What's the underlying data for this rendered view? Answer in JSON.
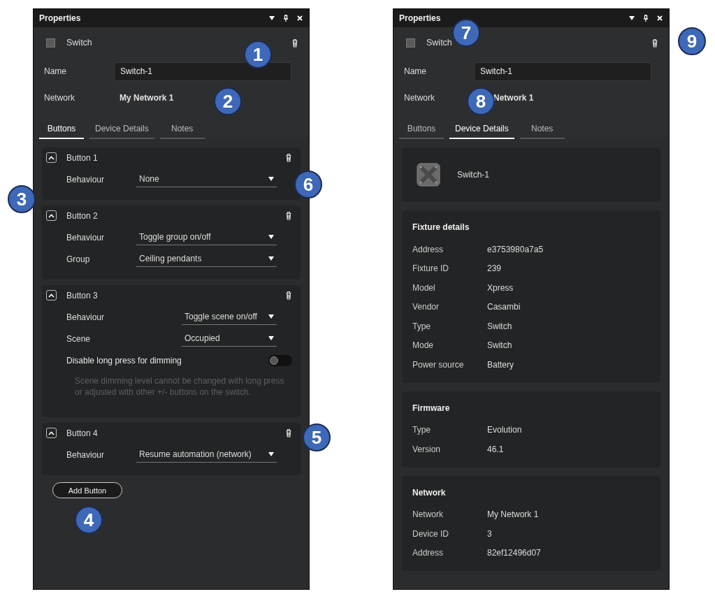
{
  "panels": [
    {
      "title": "Properties",
      "header": {
        "label": "Switch"
      },
      "name_field": {
        "label": "Name",
        "value": "Switch-1"
      },
      "network": {
        "label": "Network",
        "value": "My Network 1"
      },
      "tabs": [
        {
          "label": "Buttons",
          "selected": true
        },
        {
          "label": "Device Details",
          "selected": false
        },
        {
          "label": "Notes",
          "selected": false
        }
      ],
      "content": {
        "kind": "buttons",
        "buttons": [
          {
            "title": "Button 1",
            "expanded": true,
            "rows": [
              {
                "kind": "select",
                "label": "Behaviour",
                "value": "None"
              }
            ]
          },
          {
            "title": "Button 2",
            "expanded": true,
            "rows": [
              {
                "kind": "select",
                "label": "Behaviour",
                "value": "Toggle group on/off"
              },
              {
                "kind": "select",
                "label": "Group",
                "value": "Ceiling pendants"
              }
            ]
          },
          {
            "title": "Button 3",
            "expanded": true,
            "rows": [
              {
                "kind": "select",
                "label": "Behaviour",
                "value": "Toggle scene on/off"
              },
              {
                "kind": "select",
                "label": "Scene",
                "value": "Occupied"
              },
              {
                "kind": "toggle",
                "label": "Disable long press for dimming",
                "on": false
              },
              {
                "kind": "note",
                "text": "Scene dimming level cannot be changed with long press or adjusted with other +/- buttons on the switch."
              }
            ]
          },
          {
            "title": "Button 4",
            "expanded": true,
            "rows": [
              {
                "kind": "select",
                "label": "Behaviour",
                "value": "Resume automation (network)"
              }
            ]
          }
        ],
        "add_button": "Add Button"
      }
    },
    {
      "title": "Properties",
      "header": {
        "label": "Switch"
      },
      "name_field": {
        "label": "Name",
        "value": "Switch-1"
      },
      "network": {
        "label": "Network",
        "value": "Network 1"
      },
      "tabs": [
        {
          "label": "Buttons",
          "selected": false
        },
        {
          "label": "Device Details",
          "selected": true
        },
        {
          "label": "Notes",
          "selected": false
        }
      ],
      "content": {
        "kind": "device_details",
        "device": {
          "name": "Switch-1"
        },
        "sections": [
          {
            "title": "Fixture details",
            "rows": [
              {
                "label": "Address",
                "value": "e3753980a7a5"
              },
              {
                "label": "Fixture ID",
                "value": "239"
              },
              {
                "label": "Model",
                "value": "Xpress"
              },
              {
                "label": "Vendor",
                "value": "Casambi"
              },
              {
                "label": "Type",
                "value": "Switch"
              },
              {
                "label": "Mode",
                "value": "Switch"
              },
              {
                "label": "Power source",
                "value": "Battery"
              }
            ]
          },
          {
            "title": "Firmware",
            "rows": [
              {
                "label": "Type",
                "value": "Evolution"
              },
              {
                "label": "Version",
                "value": "46.1"
              }
            ]
          },
          {
            "title": "Network",
            "rows": [
              {
                "label": "Network",
                "value": "My Network 1"
              },
              {
                "label": "Device ID",
                "value": "3"
              },
              {
                "label": "Address",
                "value": "82ef12496d07"
              }
            ]
          }
        ]
      }
    }
  ],
  "callouts": [
    {
      "number": "1"
    },
    {
      "number": "2"
    },
    {
      "number": "3"
    },
    {
      "number": "4"
    },
    {
      "number": "5"
    },
    {
      "number": "6"
    },
    {
      "number": "7"
    },
    {
      "number": "8"
    },
    {
      "number": "9"
    }
  ]
}
